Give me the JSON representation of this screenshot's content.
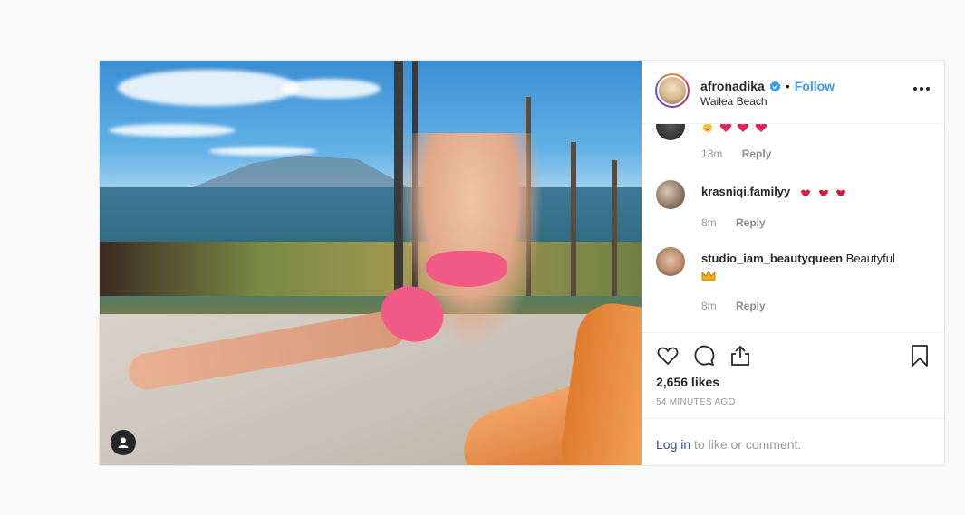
{
  "post": {
    "username": "afronadika",
    "follow_label": "Follow",
    "separator": "•",
    "location": "Wailea Beach"
  },
  "comments": [
    {
      "username": "",
      "text": "",
      "time": "13m",
      "reply_label": "Reply",
      "emojis": [
        "grin-face",
        "heart",
        "heart",
        "heart"
      ]
    },
    {
      "username": "krasniqi.familyy",
      "text": "",
      "time": "8m",
      "reply_label": "Reply",
      "emojis": [
        "heart-lips",
        "heart-lips",
        "heart-lips"
      ]
    },
    {
      "username": "studio_iam_beautyqueen",
      "text": "Beautyful",
      "time": "8m",
      "reply_label": "Reply",
      "emojis": [
        "crown"
      ]
    }
  ],
  "actions": {
    "likes": "2,656 likes",
    "timestamp": "54 MINUTES AGO",
    "login_link": "Log in",
    "login_rest": " to like or comment."
  },
  "colors": {
    "link": "#3897f0",
    "text": "#262626",
    "muted": "#999999"
  },
  "icons": [
    "verified-icon",
    "more-options-icon",
    "heart-icon",
    "comment-icon",
    "share-icon",
    "bookmark-icon",
    "user-tag-icon"
  ]
}
